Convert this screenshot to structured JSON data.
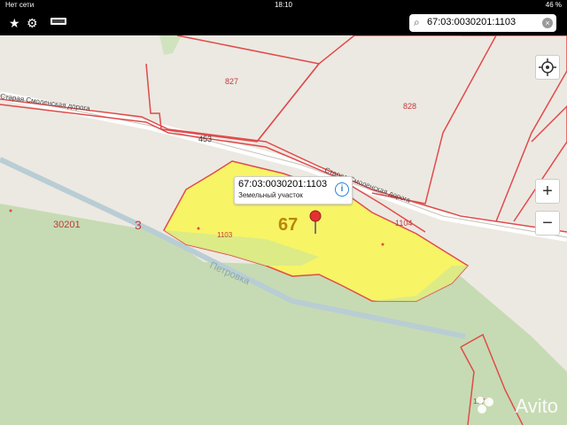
{
  "status": {
    "carrier": "Нет сети",
    "time": "18:10",
    "battery": "46 %"
  },
  "toolbar": {
    "favorites_icon": "star-icon",
    "settings_icon": "gears-icon",
    "layers_icon": "layers-icon"
  },
  "search": {
    "value": "67:03:0030201:1103"
  },
  "map_labels": {
    "parcel_827": "827",
    "parcel_828": "828",
    "road_453": "453",
    "parcel_1104": "1104",
    "parcel_1103": "1103",
    "block_30201": "30201",
    "num_3": "3",
    "region_67": "67",
    "parcel_1272": "1272",
    "road_name_left": "Старая Смоленская дорога",
    "road_name_right": "Старая Смоленская дорога",
    "river": "Петровка"
  },
  "popup": {
    "title": "67:03:0030201:1103",
    "subtitle": "Земельный участок"
  },
  "controls": {
    "zoom_in": "+",
    "zoom_out": "−"
  },
  "watermark": "Avito"
}
